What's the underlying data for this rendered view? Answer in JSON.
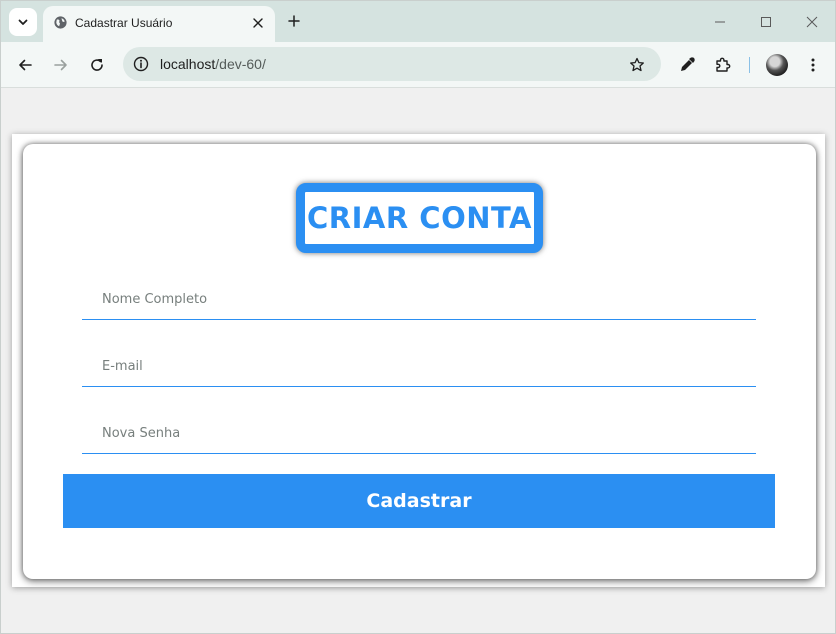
{
  "browser": {
    "tab": {
      "title": "Cadastrar Usuário"
    },
    "address": {
      "host": "localhost",
      "path": "/dev-60/"
    }
  },
  "page": {
    "heading": "CRIAR CONTA",
    "fields": [
      {
        "placeholder": "Nome Completo",
        "value": ""
      },
      {
        "placeholder": "E-mail",
        "value": ""
      },
      {
        "placeholder": "Nova Senha",
        "value": ""
      }
    ],
    "submit_label": "Cadastrar"
  },
  "colors": {
    "accent": "#2b8ff2",
    "chrome": "#d5e3e0",
    "page_bg": "#f0f0f0"
  }
}
